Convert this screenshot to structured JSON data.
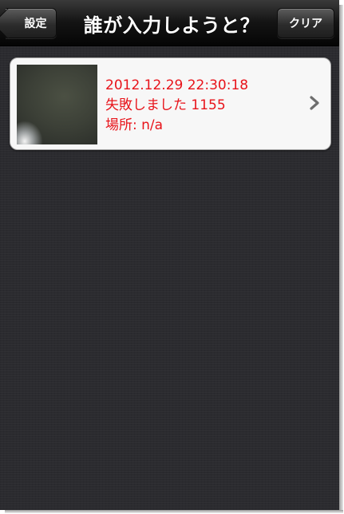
{
  "navbar": {
    "back_label": "設定",
    "title": "誰が入力しようと？",
    "clear_label": "クリア"
  },
  "entries": [
    {
      "datetime": "2012.12.29 22:30:18",
      "status": "失敗しました 1155",
      "location": "場所: n/a",
      "thumbnail": "photo-thumbnail",
      "accessory": "chevron-right-icon"
    }
  ],
  "colors": {
    "entry_text": "#e8131a",
    "background": "#2b2b2f"
  }
}
